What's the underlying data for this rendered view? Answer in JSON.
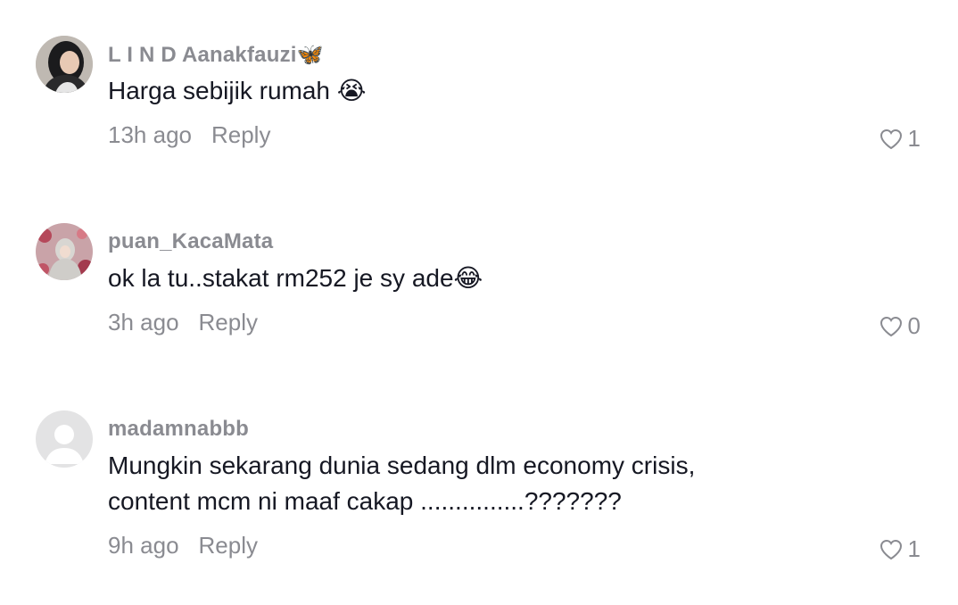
{
  "comments": [
    {
      "username": "L I N D Aanakfauzi🦋",
      "text": "Harga sebijik rumah 😭",
      "time": "13h ago",
      "reply": "Reply",
      "likes": "1"
    },
    {
      "username": "puan_KacaMata",
      "text": "ok la tu..stakat rm252 je sy ade😂",
      "time": "3h ago",
      "reply": "Reply",
      "likes": "0"
    },
    {
      "username": "madamnabbb",
      "text": "Mungkin sekarang dunia sedang dlm economy crisis,\ncontent mcm ni maaf cakap ...............???????",
      "time": "9h ago",
      "reply": "Reply",
      "likes": "1"
    }
  ],
  "icons": {
    "like": "heart-outline-icon",
    "default_avatar": "person-silhouette-icon"
  },
  "colors": {
    "username": "#8a8b91",
    "text": "#161823",
    "meta": "#8a8b91",
    "background": "#ffffff"
  }
}
